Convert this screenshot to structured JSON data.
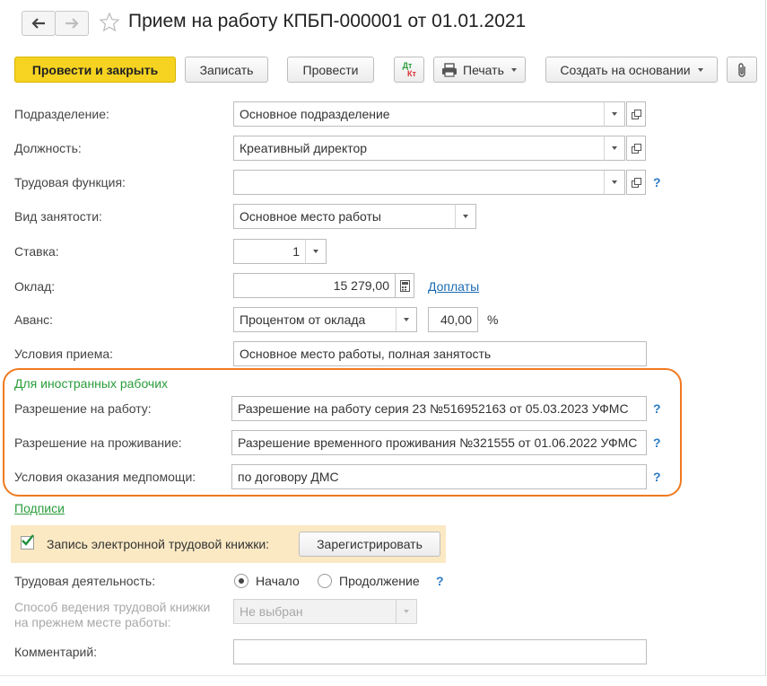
{
  "window": {
    "title": "Прием на работу КПБП-000001 от 01.01.2021"
  },
  "toolbar": {
    "post_close": "Провести и закрыть",
    "save": "Записать",
    "post": "Провести",
    "dt_label": "Дт",
    "kt_label": "Кт",
    "print": "Печать",
    "create_based": "Создать на основании"
  },
  "form": {
    "department": {
      "label": "Подразделение:",
      "value": "Основное подразделение"
    },
    "position": {
      "label": "Должность:",
      "value": "Креативный директор"
    },
    "labor_function": {
      "label": "Трудовая функция:",
      "value": ""
    },
    "employment_type": {
      "label": "Вид занятости:",
      "value": "Основное место работы"
    },
    "rate": {
      "label": "Ставка:",
      "value": "1"
    },
    "salary": {
      "label": "Оклад:",
      "value": "15 279,00",
      "link": "Доплаты"
    },
    "advance": {
      "label": "Аванс:",
      "value": "Процентом от оклада",
      "percent": "40,00",
      "unit": "%"
    },
    "conditions": {
      "label": "Условия приема:",
      "value": "Основное место работы, полная занятость"
    }
  },
  "foreign": {
    "heading": "Для иностранных рабочих",
    "work_permit": {
      "label": "Разрешение на работу:",
      "value": "Разрешение на работу серия 23 №516952163 от 05.03.2023 УФМС"
    },
    "residence_permit": {
      "label": "Разрешение на проживание:",
      "value": "Разрешение временного проживания №321555 от 01.06.2022 УФМС"
    },
    "medical": {
      "label": "Условия оказания медпомощи:",
      "value": "по договору ДМС"
    }
  },
  "signatures_link": "Подписи",
  "etk": {
    "label": "Запись электронной трудовой книжки:",
    "checked": true,
    "button": "Зарегистрировать"
  },
  "work_activity": {
    "label": "Трудовая деятельность:",
    "options": [
      "Начало",
      "Продолжение"
    ],
    "selected": "Начало"
  },
  "previous_book": {
    "label_line1": "Способ ведения трудовой книжки",
    "label_line2": "на прежнем месте работы:",
    "value": "Не выбран"
  },
  "comment": {
    "label": "Комментарий:",
    "value": ""
  },
  "help_mark": "?",
  "colors": {
    "highlight": "#f07a1e",
    "accent_yellow": "#f6d321",
    "etk_bg": "#fbe9c4",
    "green": "#2a9d3a",
    "link_blue": "#1d6bb3"
  },
  "icons": [
    "arrow-left-icon",
    "arrow-right-icon",
    "star-icon",
    "printer-icon",
    "paperclip-icon",
    "calculator-icon",
    "open-icon",
    "help-icon",
    "checkbox-icon",
    "radio-icon"
  ]
}
